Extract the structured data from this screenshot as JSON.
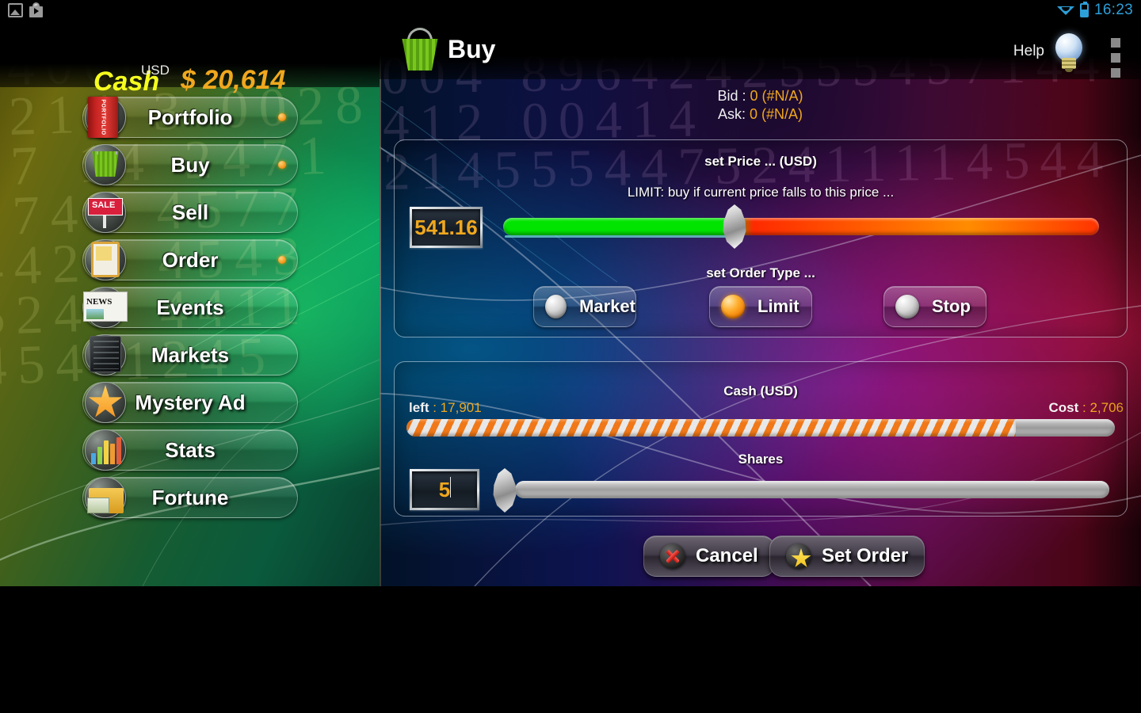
{
  "statusbar": {
    "left_icons": [
      "image-icon",
      "play-store-icon"
    ],
    "wifi_icon": "wifi-icon",
    "battery_icon": "battery-icon",
    "time": "16:23",
    "accent": "#2d9fd9"
  },
  "sidebar": {
    "cash_label": "Cash",
    "cash_currency_sup": "USD",
    "cash_value": "$ 20,614",
    "cash_label_color": "#f6ff1f",
    "cash_value_color": "#f0a81e",
    "items": [
      {
        "label": "Portfolio",
        "icon": "portfolio-icon",
        "dot": true
      },
      {
        "label": "Buy",
        "icon": "basket-icon",
        "dot": true
      },
      {
        "label": "Sell",
        "icon": "sale-sign-icon",
        "dot": false
      },
      {
        "label": "Order",
        "icon": "clipboard-icon",
        "dot": true
      },
      {
        "label": "Events",
        "icon": "newspaper-icon",
        "dot": false
      },
      {
        "label": "Markets",
        "icon": "server-icon",
        "dot": false
      },
      {
        "label": "Mystery Ad",
        "icon": "star-icon",
        "dot": false
      },
      {
        "label": "Stats",
        "icon": "bar-chart-icon",
        "dot": false
      },
      {
        "label": "Fortune",
        "icon": "money-icon",
        "dot": false
      }
    ]
  },
  "header": {
    "icon": "basket-icon",
    "title": "Buy",
    "help_label": "Help",
    "help_icon": "lightbulb-icon",
    "overflow_icon": "kebab-menu-icon"
  },
  "quote": {
    "bid_label": "Bid :",
    "bid_value": "0 (#N/A)",
    "ask_label": "Ask:",
    "ask_value": "0 (#N/A)"
  },
  "price_panel": {
    "title": "set Price ... (USD)",
    "subtitle": "LIMIT: buy if current price falls to this price ...",
    "price_value": "541.16",
    "slider_percent": 37,
    "order_type_title": "set Order Type ...",
    "order_types": [
      {
        "label": "Market",
        "selected": false
      },
      {
        "label": "Limit",
        "selected": true
      },
      {
        "label": "Stop",
        "selected": false
      }
    ]
  },
  "cash_panel": {
    "title": "Cash   (USD)",
    "left_label": "left",
    "left_sep": ": 17,901",
    "cost_label": "Cost",
    "cost_sep": ": 2,706",
    "bar_percent": 86,
    "shares_title": "Shares",
    "shares_value": "5",
    "shares_slider_percent": 0
  },
  "actions": {
    "cancel_label": "Cancel",
    "cancel_icon": "cancel-x-icon",
    "set_order_label": "Set Order",
    "set_order_icon": "star-icon"
  },
  "digits_left": "0321 4400021 1214 3 0028 27 14 2471 8745 4577 4424 4543 5240 4411 454 1245",
  "digits_right": "901245421910 45 1444 9004 8964242555457144 4412 00414 521455544752411114544"
}
